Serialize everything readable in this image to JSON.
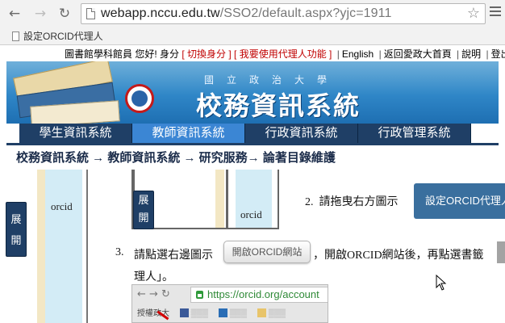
{
  "browser": {
    "url_host": "webapp.nccu.edu.tw",
    "url_path": "/SSO2/default.aspx?yjc=1911",
    "bookmark_label": "設定ORCID代理人"
  },
  "top_links": {
    "greeting": "圖書館學科館員 您好! 身分",
    "switch_identity": "[ 切換身分 ]",
    "proxy_function": "[ 我要使用代理人功能 ]",
    "english": "English",
    "home": "返回愛政大首頁",
    "help": "說明",
    "logout": "登出"
  },
  "banner": {
    "subtitle": "國立政治大學",
    "title": "校務資訊系統"
  },
  "tabs": [
    {
      "label": "學生資訊系統",
      "active": false
    },
    {
      "label": "教師資訊系統",
      "active": true
    },
    {
      "label": "行政資訊系統",
      "active": false
    },
    {
      "label": "行政管理系統",
      "active": false
    }
  ],
  "breadcrumb": "校務資訊系統 → 教師資訊系統 → 研究服務→ 論著目錄維護",
  "content": {
    "expand_label_left": "展開",
    "expand_label_inner_1": "展",
    "expand_label_inner_2": "開",
    "orcid_left": "orcid",
    "orcid_inner": "orcid",
    "step2_number": "2.",
    "step2_text": "請拖曳右方圖示",
    "step2_button": "設定ORCID代理人",
    "step3_number": "3.",
    "step3_prefix": "請點選右邊圖示",
    "step3_button": "開啟ORCID網站",
    "step3_suffix": "，開啟ORCID網站後，再點選書籤",
    "step3_line2": "理人」。"
  },
  "embedded_screenshot": {
    "url": "https://orcid.org/account",
    "bookmarks": [
      "授權政大",
      "",
      "",
      ""
    ]
  }
}
